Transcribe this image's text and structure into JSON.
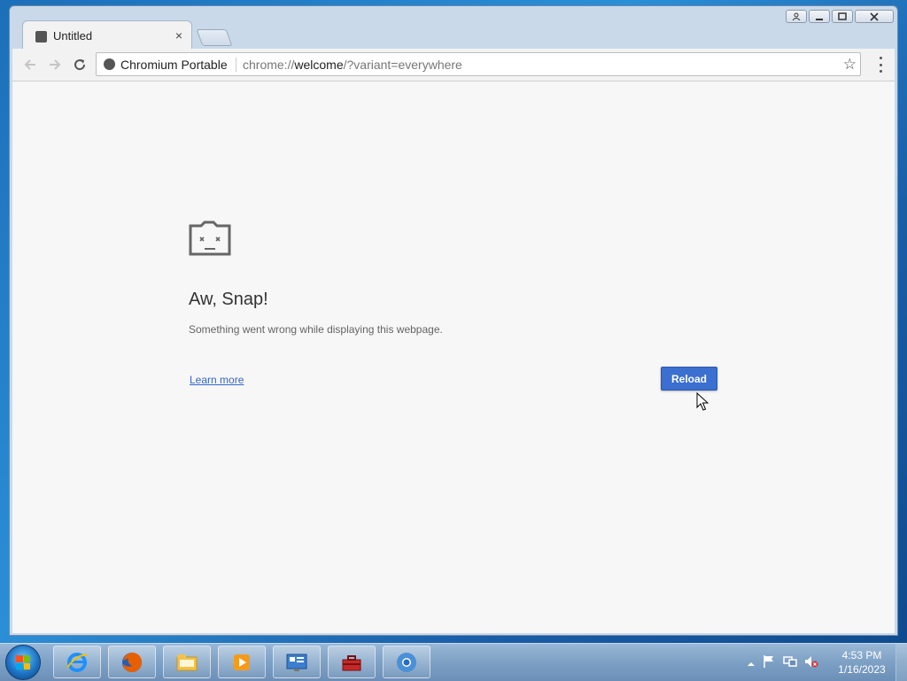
{
  "browser": {
    "tab": {
      "title": "Untitled",
      "close_label": "×"
    },
    "omnibox": {
      "site_name": "Chromium Portable",
      "url_scheme": "chrome://",
      "url_host": "welcome",
      "url_rest": "/?variant=everywhere"
    }
  },
  "page": {
    "icon": "sad-folder-icon",
    "heading": "Aw, Snap!",
    "message": "Something went wrong while displaying this webpage.",
    "learn_more": "Learn more",
    "reload_button": "Reload"
  },
  "taskbar": {
    "pinned": [
      "internet-explorer-icon",
      "firefox-icon",
      "file-explorer-icon",
      "media-player-icon",
      "control-panel-icon",
      "toolbox-icon",
      "chromium-icon"
    ],
    "clock": {
      "time": "4:53 PM",
      "date": "1/16/2023"
    }
  }
}
